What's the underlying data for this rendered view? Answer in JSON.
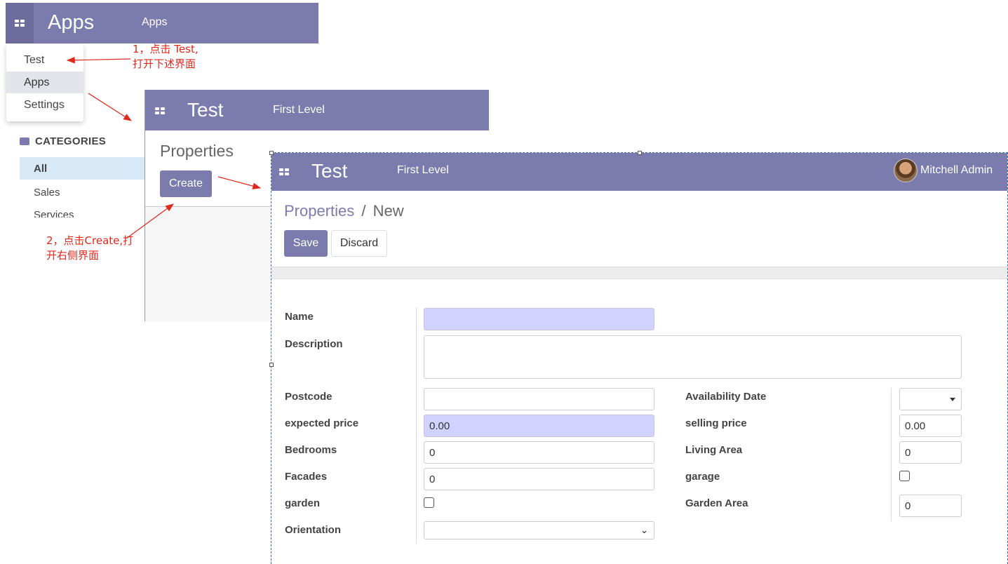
{
  "apps_window": {
    "app_title": "Apps",
    "menu_link": "Apps",
    "dropdown": [
      "Test",
      "Apps",
      "Settings"
    ],
    "categories_title": "CATEGORIES",
    "categories": [
      "All",
      "Sales",
      "Services"
    ]
  },
  "test_window": {
    "app_title": "Test",
    "menu_link": "First Level",
    "breadcrumb": "Properties",
    "create_label": "Create"
  },
  "form_window": {
    "app_title": "Test",
    "menu_link": "First Level",
    "user_name": "Mitchell Admin",
    "breadcrumb_parent": "Properties",
    "breadcrumb_sep": "/",
    "breadcrumb_current": "New",
    "save_label": "Save",
    "discard_label": "Discard",
    "fields": {
      "name": {
        "label": "Name",
        "value": ""
      },
      "description": {
        "label": "Description",
        "value": ""
      },
      "postcode": {
        "label": "Postcode",
        "value": ""
      },
      "expected_price": {
        "label": "expected price",
        "value": "0.00"
      },
      "bedrooms": {
        "label": "Bedrooms",
        "value": "0"
      },
      "facades": {
        "label": "Facades",
        "value": "0"
      },
      "garden": {
        "label": "garden",
        "checked": false
      },
      "orientation": {
        "label": "Orientation",
        "value": ""
      },
      "availability_date": {
        "label": "Availability Date",
        "value": ""
      },
      "selling_price": {
        "label": "selling price",
        "value": "0.00"
      },
      "living_area": {
        "label": "Living Area",
        "value": "0"
      },
      "garage": {
        "label": "garage",
        "checked": false
      },
      "garden_area": {
        "label": "Garden Area",
        "value": "0"
      }
    }
  },
  "annotations": {
    "step1_line1": "1，点击 Test,",
    "step1_line2": "打开下述界面",
    "step2_line1": "2，点击Create,打",
    "step2_line2": "开右侧界面"
  },
  "colors": {
    "navbar": "#7c7bad",
    "required_field": "#d2d2ff",
    "annotation": "#e0281c",
    "primary_button": "#7c7bad"
  }
}
